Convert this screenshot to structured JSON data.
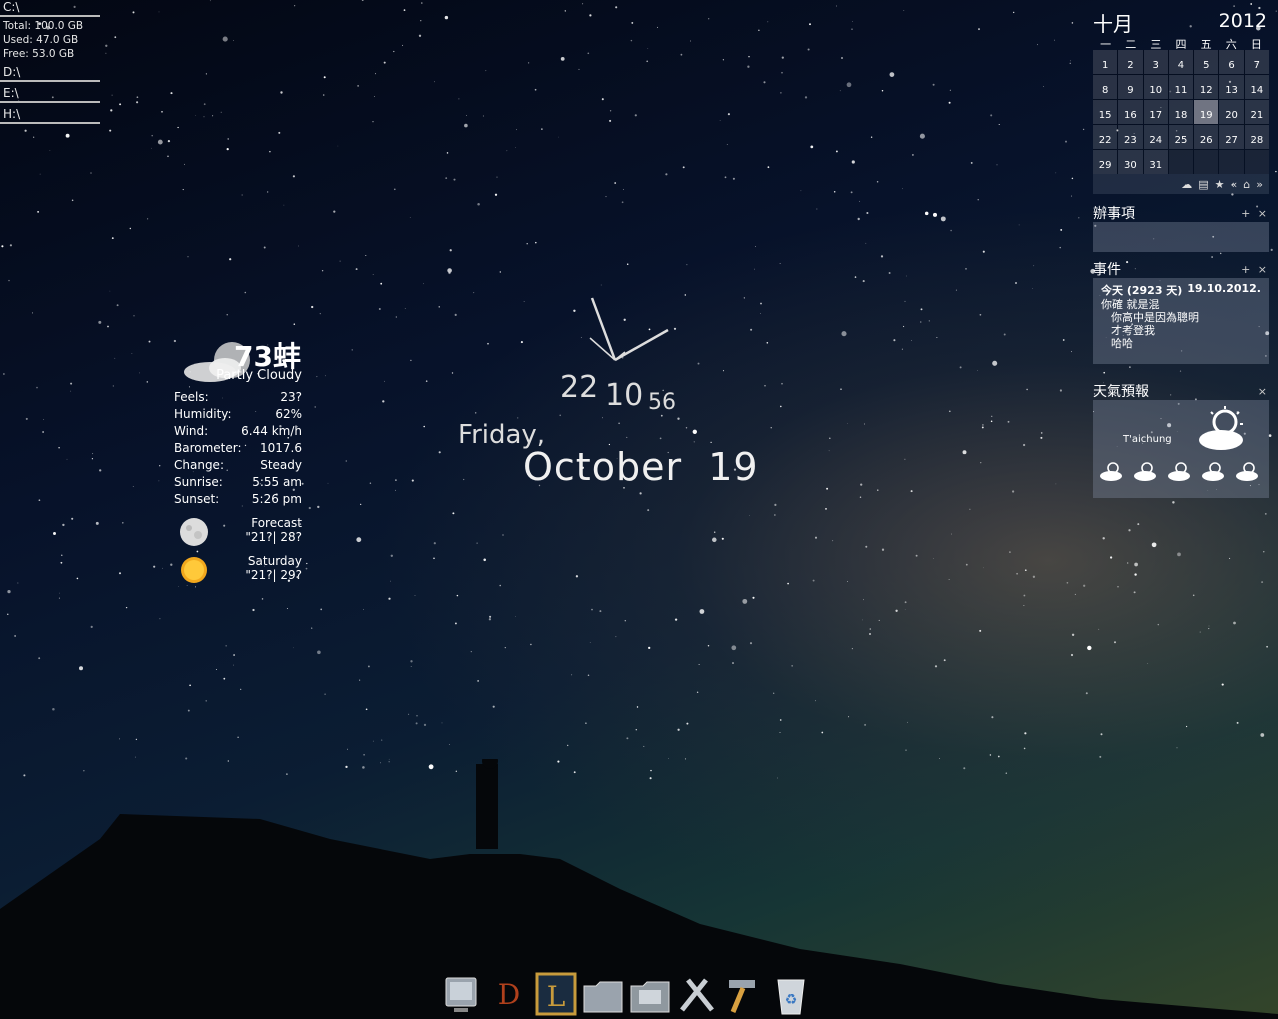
{
  "drives": [
    {
      "letter": "C:\\",
      "lines": [
        "Total: 100.0 GB",
        "Used: 47.0 GB",
        "Free: 53.0 GB"
      ]
    },
    {
      "letter": "D:\\",
      "lines": []
    },
    {
      "letter": "E:\\",
      "lines": []
    },
    {
      "letter": "H:\\",
      "lines": []
    }
  ],
  "weather": {
    "temp": "73蚌",
    "condition": "Partly Cloudy",
    "rows": [
      {
        "label": "Feels:",
        "value": "23?"
      },
      {
        "label": "Humidity:",
        "value": "62%"
      },
      {
        "label": "Wind:",
        "value": "6.44 km/h"
      },
      {
        "label": "Barometer:",
        "value": "1017.6"
      },
      {
        "label": "Change:",
        "value": "Steady"
      },
      {
        "label": "Sunrise:",
        "value": "5:55 am"
      },
      {
        "label": "Sunset:",
        "value": "5:26 pm"
      }
    ],
    "forecast1": {
      "day": "Forecast",
      "temps": "\"21?| 28?"
    },
    "forecast2": {
      "day": "Saturday",
      "temps": "\"21?| 29?"
    }
  },
  "clock": {
    "hour": "22",
    "minute": "10",
    "second": "56",
    "weekday": "Friday,",
    "date": "October  19"
  },
  "calendar": {
    "month": "十月",
    "year": "2012",
    "weekdays": [
      "一",
      "二",
      "三",
      "四",
      "五",
      "六",
      "日"
    ],
    "days": [
      "1",
      "2",
      "3",
      "4",
      "5",
      "6",
      "7",
      "8",
      "9",
      "10",
      "11",
      "12",
      "13",
      "14",
      "15",
      "16",
      "17",
      "18",
      "19",
      "20",
      "21",
      "22",
      "23",
      "24",
      "25",
      "26",
      "27",
      "28",
      "29",
      "30",
      "31"
    ],
    "today": "19",
    "tools": [
      "☁",
      "▤",
      "★",
      "«",
      "⌂",
      "»"
    ]
  },
  "todo": {
    "title": "辦事項",
    "controls": "+ ×"
  },
  "events": {
    "title": "事件",
    "controls": "+ ×",
    "head_left": "今天 (2923 天)",
    "head_right": "19.10.2012.",
    "lines": [
      "你確 就是混",
      "你高中是因為聰明",
      "才考登我",
      "哈哈"
    ]
  },
  "forecast": {
    "title": "天氣預報",
    "controls": "×",
    "city": "T'aichung"
  },
  "dock": [
    "monitor-icon",
    "diablo-icon",
    "league-icon",
    "folder-icon",
    "pictures-folder-icon",
    "tools-icon",
    "hammer-icon",
    "recycle-bin-icon"
  ]
}
